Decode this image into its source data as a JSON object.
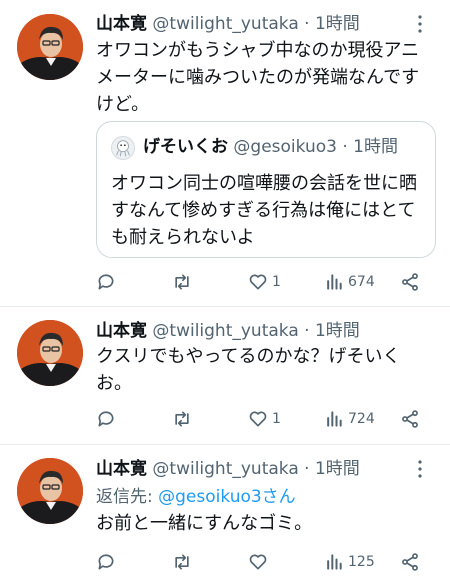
{
  "tweets": [
    {
      "name": "山本寛",
      "handle": "@twilight_yutaka",
      "sep": "·",
      "time": "1時間",
      "text": "オワコンがもうシャブ中なのか現役アニメーターに噛みついたのが発端なんですけど。",
      "quote": {
        "name": "げそいくお",
        "handle": "@gesoikuo3",
        "sep": "·",
        "time": "1時間",
        "text": "オワコン同士の喧嘩腰の会話を世に晒すなんて惨めすぎる行為は俺にはとても耐えられないよ"
      },
      "likes": "1",
      "views": "674"
    },
    {
      "name": "山本寛",
      "handle": "@twilight_yutaka",
      "sep": "·",
      "time": "1時間",
      "text": "クスリでもやってるのかな？げそいくお。",
      "likes": "1",
      "views": "724"
    },
    {
      "name": "山本寛",
      "handle": "@twilight_yutaka",
      "sep": "·",
      "time": "1時間",
      "reply_prefix": "返信先: ",
      "reply_to": "@gesoikuo3さん",
      "text": "お前と一緒にすんなゴミ。",
      "views": "125"
    }
  ],
  "colors": {
    "text": "#0f1419",
    "secondary": "#536471",
    "link": "#1d9bf0",
    "divider": "#e7ebee"
  }
}
